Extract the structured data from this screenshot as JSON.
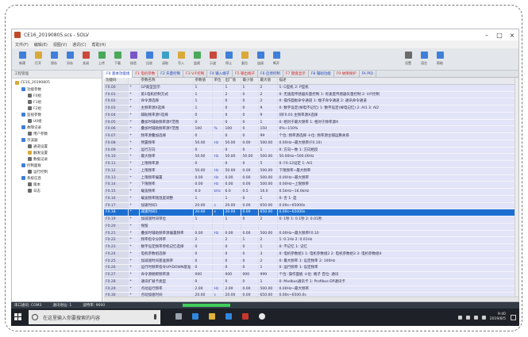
{
  "app": {
    "title": "CE16_20190805.scs - SOLV",
    "window_buttons": [
      "–",
      "□",
      "×"
    ]
  },
  "menu": [
    "文件(F)",
    "编辑(E)",
    "视图(V)",
    "通讯(C)",
    "帮助(H)"
  ],
  "toolbar": [
    {
      "label": "新建",
      "color": "#3f7fd8"
    },
    {
      "label": "打开",
      "color": "#d9a93a"
    },
    {
      "label": "保存",
      "color": "#3f7fd8"
    },
    {
      "label": "另存",
      "color": "#3f7fd8"
    },
    {
      "label": "关闭",
      "color": "#c94a3a"
    },
    {
      "label": "上传",
      "color": "#4aa85a"
    },
    {
      "label": "下载",
      "color": "#4aa85a"
    },
    {
      "label": "校验",
      "color": "#7a57c7"
    },
    {
      "label": "比较",
      "color": "#3f7fd8"
    },
    {
      "label": "读取",
      "color": "#3aa0c9"
    },
    {
      "label": "写入",
      "color": "#d9a93a"
    },
    {
      "label": "监视",
      "color": "#4aa85a"
    },
    {
      "label": "示波",
      "color": "#c94a3a"
    },
    {
      "label": "停止",
      "color": "#3f7fd8"
    },
    {
      "label": "复位",
      "color": "#d9a93a"
    },
    {
      "label": "连接",
      "color": "#3f7fd8"
    },
    {
      "label": "断开",
      "color": "#3f7fd8"
    },
    {
      "label": "设置",
      "color": "#6b6b6b"
    },
    {
      "label": "语言",
      "color": "#3f7fd8"
    },
    {
      "label": "帮助",
      "color": "#3f7fd8"
    }
  ],
  "tree": {
    "header": "工程管理",
    "nodes": [
      {
        "label": "CE16_20190805",
        "indent": 0,
        "color": "#d9a93a"
      },
      {
        "label": "功能参数",
        "indent": 1,
        "color": "#3f7fd8"
      },
      {
        "label": "F0组",
        "indent": 2,
        "color": "#6b6b6b"
      },
      {
        "label": "F1组",
        "indent": 2,
        "color": "#6b6b6b"
      },
      {
        "label": "F2组",
        "indent": 2,
        "color": "#6b6b6b"
      },
      {
        "label": "监视参数",
        "indent": 1,
        "color": "#3f7fd8"
      },
      {
        "label": "U0组",
        "indent": 2,
        "color": "#6b6b6b"
      },
      {
        "label": "故障记录",
        "indent": 1,
        "color": "#3f7fd8"
      },
      {
        "label": "用户参数",
        "indent": 2,
        "color": "#6b6b6b"
      },
      {
        "label": "示波器",
        "indent": 1,
        "color": "#3f7fd8"
      },
      {
        "label": "通道设置",
        "indent": 2,
        "color": "#6b6b6b"
      },
      {
        "label": "触发设置",
        "indent": 2,
        "color": "#d9a93a"
      },
      {
        "label": "数据记录",
        "indent": 2,
        "color": "#6b6b6b"
      },
      {
        "label": "控制面板",
        "indent": 1,
        "color": "#3f7fd8"
      },
      {
        "label": "运行控制",
        "indent": 2,
        "color": "#6b6b6b"
      },
      {
        "label": "系统信息",
        "indent": 1,
        "color": "#3f7fd8"
      },
      {
        "label": "版本",
        "indent": 2,
        "color": "#6b6b6b"
      },
      {
        "label": "日志",
        "indent": 2,
        "color": "#6b6b6b"
      }
    ]
  },
  "tabs": [
    {
      "label": "F0 基本功能组",
      "color": "#1d3fb5"
    },
    {
      "label": "F1 电机参数",
      "color": "#d12a2a"
    },
    {
      "label": "F2 矢量控制",
      "color": "#1d3fb5"
    },
    {
      "label": "F3 V/F控制",
      "color": "#d12a2a"
    },
    {
      "label": "F4 输入端子",
      "color": "#1d3fb5"
    },
    {
      "label": "F5 输出端子",
      "color": "#d12a2a"
    },
    {
      "label": "F6 启停控制",
      "color": "#1d3fb5"
    },
    {
      "label": "F7 键盘显示",
      "color": "#d12a2a"
    },
    {
      "label": "F8 辅助功能",
      "color": "#1d3fb5"
    },
    {
      "label": "F9 故障保护",
      "color": "#d12a2a"
    },
    {
      "label": "FA PID",
      "color": "#1d3fb5"
    }
  ],
  "table": {
    "columns": [
      "功能码",
      "",
      "参数名称",
      "参数值",
      "单位",
      "出厂值",
      "最小值",
      "最大值",
      "描述"
    ],
    "rows": [
      [
        "F0.00",
        "*",
        "GP类型显示",
        "1",
        "",
        "1",
        "1",
        "2",
        "1: G型机  2: P型机"
      ],
      [
        "F0.01",
        "*",
        "第1电机控制方式",
        "1",
        "",
        "2",
        "0",
        "2",
        "0: 无速度传感器矢量控制  1: 有速度传感器矢量控制  2: V/F控制"
      ],
      [
        "F0.02",
        "*",
        "命令源选择",
        "1",
        "",
        "0",
        "0",
        "2",
        "0: 操作面板命令通道  1: 端子命令通道  2: 通讯命令通道"
      ],
      [
        "F0.03",
        "*",
        "主频率源X选择",
        "1",
        "",
        "0",
        "0",
        "9",
        "0: 数字设定(掉电不记忆)  1: 数字设定(掉电记忆)  2: AI1  3: AI2"
      ],
      [
        "F0.04",
        "*",
        "辅助频率源Y选择",
        "0",
        "",
        "0",
        "0",
        "9",
        "同F0.03 主频率源X选择"
      ],
      [
        "F0.05",
        "*",
        "叠加时辅助频率源Y范围",
        "0",
        "",
        "0",
        "0",
        "1",
        "0: 相对于最大频率  1: 相对于频率源X"
      ],
      [
        "F0.06",
        "*",
        "叠加时辅助频率源Y范围",
        "100",
        "%",
        "100",
        "0",
        "150",
        "0%~150%"
      ],
      [
        "F0.07",
        "*",
        "频率源叠加选择",
        "0",
        "",
        "0",
        "0",
        "99",
        "个位: 频率源选择  十位: 频率源主辅运算关系"
      ],
      [
        "F0.08",
        "*",
        "预置频率",
        "50.00",
        "Hz",
        "50.00",
        "0.00",
        "500.00",
        "0.00Hz~最大频率(F0.10)"
      ],
      [
        "F0.09",
        "*",
        "运行方向",
        "0",
        "",
        "0",
        "0",
        "1",
        "0: 方向一致  1: 方向相反"
      ],
      [
        "F0.10",
        "*",
        "最大频率",
        "50.00",
        "Hz",
        "50.00",
        "50.00",
        "500.00",
        "50.00Hz~500.00Hz"
      ],
      [
        "F0.11",
        "*",
        "上限频率源",
        "0",
        "",
        "0",
        "0",
        "5",
        "0: F0.12设定  1: AI1"
      ],
      [
        "F0.12",
        "*",
        "上限频率",
        "50.00",
        "Hz",
        "50.00",
        "0.00",
        "500.00",
        "下限频率~最大频率"
      ],
      [
        "F0.13",
        "*",
        "上限频率偏置",
        "0.00",
        "Hz",
        "0.00",
        "0.00",
        "500.00",
        "0.00Hz~最大频率"
      ],
      [
        "F0.14",
        "*",
        "下限频率",
        "0.00",
        "Hz",
        "0.00",
        "0.00",
        "500.00",
        "0.00Hz~上限频率"
      ],
      [
        "F0.15",
        "*",
        "载波频率",
        "6.0",
        "kHz",
        "6.0",
        "0.5",
        "16.0",
        "0.5kHz~16.0kHz"
      ],
      [
        "F0.16",
        "*",
        "载波频率随温度调整",
        "1",
        "",
        "1",
        "0",
        "1",
        "0: 否  1: 是"
      ],
      [
        "F0.17",
        "*",
        "加速时间1",
        "20.00",
        "s",
        "20.00",
        "0.00",
        "650.00",
        "0.00s~65000s"
      ],
      [
        "F0.18",
        "*",
        "减速时间1",
        "20.00",
        "s",
        "20.00",
        "0.00",
        "650.00",
        "0.00s~65000s"
      ],
      [
        "F0.19",
        "*",
        "加减速时间单位",
        "1",
        "",
        "1",
        "0",
        "2",
        "0: 1秒  1: 0.1秒  2: 0.01秒"
      ],
      [
        "F0.20",
        "*",
        "保留",
        "",
        "",
        "",
        "",
        "",
        ""
      ],
      [
        "F0.21",
        "*",
        "叠加时辅助频率源偏置频率",
        "0.00",
        "Hz",
        "0.00",
        "0.00",
        "500.00",
        "0.00Hz~最大频率F0.10"
      ],
      [
        "F0.22",
        "*",
        "频率指令分辨率",
        "2",
        "",
        "2",
        "1",
        "2",
        "1: 0.1Hz  2: 0.01Hz"
      ],
      [
        "F0.23",
        "*",
        "数字设定频率停机记忆选择",
        "0",
        "",
        "0",
        "0",
        "1",
        "0: 不记忆  1: 记忆"
      ],
      [
        "F0.24",
        "*",
        "电机参数组选择",
        "0",
        "",
        "0",
        "0",
        "3",
        "0: 电机参数组1  1: 电机参数组2  2: 电机参数组3  3: 电机参数组4"
      ],
      [
        "F0.25",
        "*",
        "加减速时间基准频率",
        "0",
        "",
        "0",
        "0",
        "2",
        "0: 最大频率  1: 设定频率  2: 100Hz"
      ],
      [
        "F0.26",
        "*",
        "运行时频率指令UP/DOWN基准",
        "0",
        "",
        "0",
        "0",
        "1",
        "0: 运行频率  1: 设定频率"
      ],
      [
        "F0.27",
        "*",
        "命令源捆绑频率源",
        "000",
        "",
        "000",
        "000",
        "999",
        "个位: 操作面板  十位: 端子  百位: 通讯"
      ],
      [
        "F0.28",
        "*",
        "通讯扩展卡类型",
        "0",
        "",
        "0",
        "0",
        "1",
        "0: Modbus通讯卡  1: Profibus-DP通讯卡"
      ],
      [
        "F0.29",
        "*",
        "点动运行频率",
        "2.00",
        "Hz",
        "2.00",
        "0.00",
        "500.00",
        "0.00Hz~最大频率"
      ],
      [
        "F0.30",
        "*",
        "点动加速时间",
        "20.00",
        "s",
        "20.00",
        "0.00",
        "650.00",
        "0.00s~6500.0s"
      ],
      [
        "F0.31",
        "*",
        "点动减速时间",
        "20.00",
        "s",
        "20.00",
        "0.00",
        "650.00",
        "0.00s~6500.0s"
      ],
      [
        "F0.32",
        "*",
        "跳跃频率1",
        "0.00",
        "Hz",
        "0.00",
        "0.00",
        "500.00",
        "0.00Hz~最大频率"
      ],
      [
        "F0.33",
        "*",
        "跳跃频率2",
        "0.00",
        "Hz",
        "0.00",
        "0.00",
        "500.00",
        "0.00Hz~最大频率"
      ],
      [
        "F0.34",
        "*",
        "跳跃频率幅度",
        "0.00",
        "Hz",
        "0.00",
        "0.00",
        "500.00",
        "0.00Hz~最大频率"
      ]
    ],
    "selected_index": 18
  },
  "statusbar": {
    "items": [
      "串口通讯: COM3",
      "通讯地址: 1",
      "波特率: 9600"
    ],
    "progress": 1.0
  },
  "taskbar": {
    "search_placeholder": "在这里输入你要搜索的内容",
    "apps": [
      {
        "name": "task-view",
        "color": "#9aa3ad"
      },
      {
        "name": "edge",
        "color": "#2f86de"
      },
      {
        "name": "explorer",
        "color": "#e0b43c"
      },
      {
        "name": "store",
        "color": "#2f86de"
      },
      {
        "name": "solv",
        "color": "#c8372d"
      },
      {
        "name": "chrome",
        "color": "#e8e8e8"
      }
    ],
    "time": "9:40",
    "date": "2019/8/5"
  }
}
